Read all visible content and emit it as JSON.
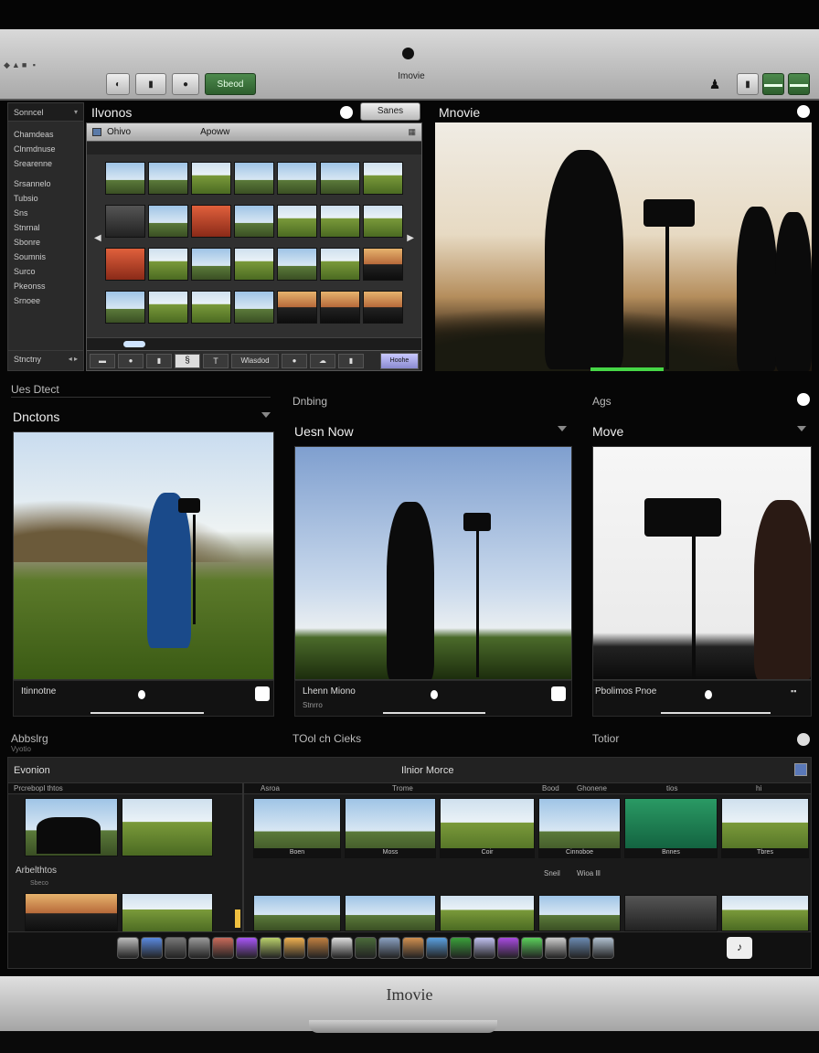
{
  "window": {
    "title": "Imovie",
    "brand": "Imovie"
  },
  "toolbar": {
    "buttons": [
      "◐",
      "▮",
      "●",
      "Sbeod"
    ],
    "right_buttons": [
      "▮",
      "▬▬",
      "▬▬"
    ]
  },
  "sidebar": {
    "header": "Sonncel",
    "items": [
      "Chamdeas",
      "Clnmdnuse",
      "Srearenne",
      "Srsannelo",
      "Tubsio",
      "Sns",
      "Stnrnal",
      "Sbonre",
      "Soumnis",
      "Surco",
      "Pkeonss",
      "Srnoee"
    ],
    "footer": "Stnctny"
  },
  "browser": {
    "section_title": "Ilvonos",
    "search_button": "Sanes",
    "header_left": "Ohivo",
    "header_center": "Apoww",
    "bottom_label": "Wlasdod",
    "bottom_right": "Hoohe"
  },
  "viewer": {
    "title": "Mnovie"
  },
  "mid_sections": {
    "left_caption": "Ues Dtect",
    "left_title": "Dnctons",
    "center_caption": "Dnbing",
    "center_title": "Uesn Now",
    "right_caption": "Ags",
    "right_title": "Move"
  },
  "cards": [
    {
      "footer": "Itinnotne",
      "sub": ""
    },
    {
      "footer": "Lhenn Miono",
      "sub": "Stnrro"
    },
    {
      "footer": "Pbolimos Pnoe",
      "sub": ""
    }
  ],
  "bottom": {
    "left_caption": "Abbslrg",
    "left_sub": "Vyotio",
    "center_caption": "TOol ch Cieks",
    "right_caption": "Totior",
    "timeline_title": "Evonion",
    "timeline_center": "Ilnior Morce",
    "library_label": "Prcrebopl thtos",
    "library_label2": "Arbelthtos",
    "library_sub": "Sbeco",
    "track_labels": [
      "Asroa",
      "Trome",
      "Bood",
      "Ghonene",
      "tios",
      "hi"
    ],
    "clip_labels": [
      "Boen",
      "Moss",
      "Coir",
      "Cinnoboe",
      "Bnnes",
      "Tbres"
    ],
    "clip_labels_row2": [
      "Sneil",
      "Wioa lll"
    ]
  }
}
